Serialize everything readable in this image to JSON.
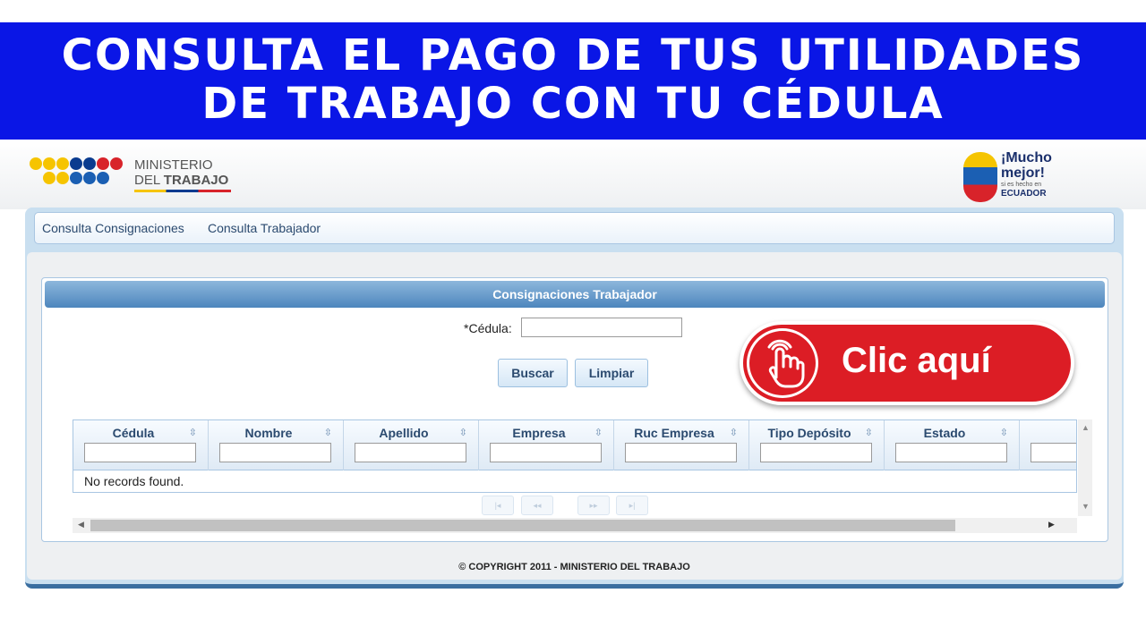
{
  "banner": {
    "line1": "CONSULTA EL PAGO DE TUS UTILIDADES",
    "line2": "DE TRABAJO CON TU CÉDULA"
  },
  "header": {
    "ministry_line1": "MINISTERIO",
    "ministry_line2_prefix": "DEL ",
    "ministry_line2_bold": "TRABAJO",
    "ecuador_logo": {
      "line1": "¡Mucho",
      "line2": "mejor!",
      "line3": "si es hecho en",
      "line4": "ECUADOR"
    }
  },
  "menu": {
    "items": [
      "Consulta Consignaciones",
      "Consulta Trabajador"
    ]
  },
  "panel": {
    "title": "Consignaciones Trabajador",
    "cedula_required_mark": "*",
    "cedula_label": "Cédula:",
    "cedula_value": "",
    "buscar_label": "Buscar",
    "limpiar_label": "Limpiar"
  },
  "table": {
    "columns": [
      "Cédula",
      "Nombre",
      "Apellido",
      "Empresa",
      "Ruc Empresa",
      "Tipo Depósito",
      "Estado"
    ],
    "sort_icon": "⇳",
    "empty_message": "No records found.",
    "pager": [
      "|◂",
      "◂◂",
      "▸▸",
      "▸|"
    ]
  },
  "footer": {
    "copyright": "© COPYRIGHT 2011 - MINISTERIO DEL TRABAJO"
  },
  "cta": {
    "label": "Clic aquí",
    "icon": "hand-pointer-icon"
  },
  "colors": {
    "banner": "#0a16e6",
    "cta": "#dc1d25",
    "panel_header": "#4d86bd"
  }
}
